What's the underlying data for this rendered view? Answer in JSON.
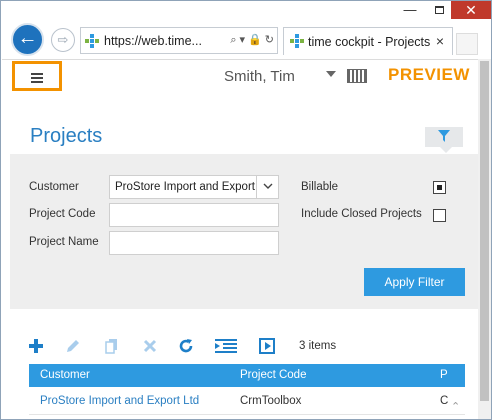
{
  "browser": {
    "window_controls": {
      "minimize": "—",
      "close": "✕"
    },
    "address": "https://web.time...",
    "tab_title": "time cockpit - Projects",
    "tab_close": "×"
  },
  "header": {
    "user_name": "Smith, Tim",
    "preview_label": "PREVIEW"
  },
  "page": {
    "title": "Projects"
  },
  "filter": {
    "customer_label": "Customer",
    "customer_value": "ProStore Import and Export Ltd",
    "project_code_label": "Project Code",
    "project_code_value": "",
    "project_name_label": "Project Name",
    "project_name_value": "",
    "billable_label": "Billable",
    "billable_checked": true,
    "include_closed_label": "Include Closed Projects",
    "include_closed_checked": false,
    "apply_label": "Apply Filter"
  },
  "toolbar": {
    "items_count": "3 items"
  },
  "table": {
    "columns": [
      "Customer",
      "Project Code",
      "P"
    ],
    "rows": [
      [
        "ProStore Import and Export Ltd",
        "CrmToolbox",
        "C"
      ]
    ]
  },
  "colors": {
    "accent": "#2e9ae0",
    "title_blue": "#2a7fc2",
    "preview_orange": "#f39200",
    "close_red": "#c0392b"
  },
  "icons": {
    "back": "back-arrow-icon",
    "forward": "forward-arrow-icon",
    "favicon": "time-cockpit-logo-icon",
    "search": "search-icon",
    "lock": "lock-icon",
    "refresh": "refresh-icon",
    "menu": "hamburger-icon",
    "keyboard": "keyboard-icon",
    "filter": "filter-icon",
    "add": "plus-icon",
    "edit": "pencil-icon",
    "copy": "copy-icon",
    "delete": "delete-icon",
    "reload": "refresh-icon",
    "indent": "list-indent-icon",
    "play": "play-icon"
  }
}
